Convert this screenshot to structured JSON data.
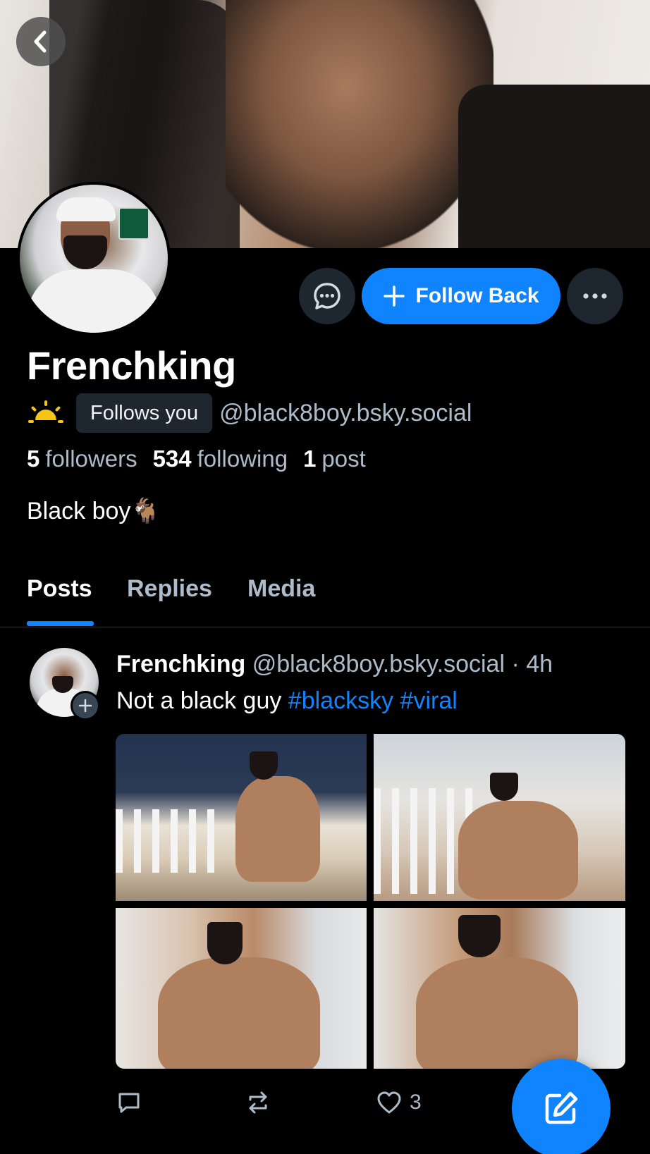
{
  "profile": {
    "display_name": "Frenchking",
    "follows_you_label": "Follows you",
    "handle": "@black8boy.bsky.social",
    "bio": "Black boy🐐",
    "stats": {
      "followers_count": "5",
      "followers_label": "followers",
      "following_count": "534",
      "following_label": "following",
      "posts_count": "1",
      "posts_label": "post"
    }
  },
  "actions": {
    "follow_back_label": "Follow Back",
    "message_icon": "chat-bubble-icon",
    "more_icon": "ellipsis-icon",
    "back_icon": "chevron-left-icon"
  },
  "tabs": [
    {
      "label": "Posts",
      "active": true
    },
    {
      "label": "Replies",
      "active": false
    },
    {
      "label": "Media",
      "active": false
    }
  ],
  "post": {
    "author_name": "Frenchking",
    "author_handle_time": "@black8boy.bsky.social · 4h",
    "text": "Not a black guy ",
    "hashtags": [
      "#blacksky",
      "#viral"
    ],
    "image_count": 4,
    "like_count": "3",
    "icons": [
      "reply-icon",
      "repost-icon",
      "like-icon"
    ]
  },
  "compose": {
    "icon": "compose-icon"
  },
  "colors": {
    "accent": "#1083fe",
    "background": "#000000",
    "muted_text": "#aebbc9",
    "chip_bg": "#1e2630"
  }
}
